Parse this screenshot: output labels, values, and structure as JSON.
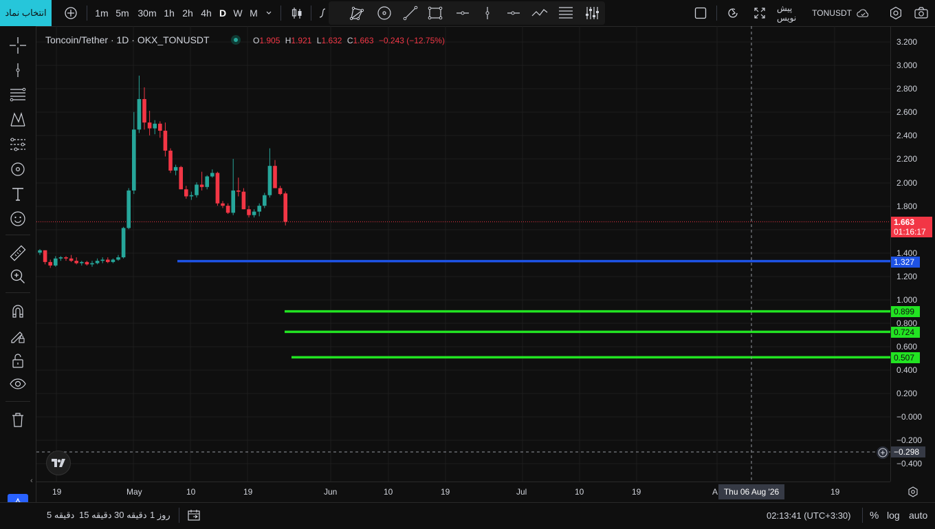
{
  "toolbar": {
    "symbol_search": "انتخاب نماد",
    "intervals": [
      "1m",
      "5m",
      "30m",
      "1h",
      "2h",
      "4h",
      "D",
      "W",
      "M"
    ],
    "active_interval": "D",
    "symbol": "TONUSDT",
    "preview_label": "پیش نویس"
  },
  "legend": {
    "title": "Toncoin/Tether · 1D · OKX_TONUSDT",
    "open_label": "O",
    "open": "1.905",
    "high_label": "H",
    "high": "1.921",
    "low_label": "L",
    "low": "1.632",
    "close_label": "C",
    "close": "1.663",
    "change": "−0.243 (−12.75%)"
  },
  "price_axis": {
    "ticks": [
      "3.200",
      "3.000",
      "2.800",
      "2.600",
      "2.400",
      "2.200",
      "2.000",
      "1.800",
      "1.400",
      "1.200",
      "1.000",
      "0.800",
      "0.600",
      "0.400",
      "0.200",
      "−0.000",
      "−0.200",
      "−0.400"
    ],
    "last_price": "1.663",
    "countdown": "01:16:17",
    "crosshair_price": "−0.298",
    "line_labels": [
      "1.327",
      "0.899",
      "0.724",
      "0.507"
    ]
  },
  "time_axis": {
    "ticks": [
      "19",
      "May",
      "10",
      "19",
      "Jun",
      "10",
      "19",
      "Jul",
      "10",
      "19",
      "A",
      "19"
    ],
    "crosshair_date": "Thu 06 Aug '26"
  },
  "bottom": {
    "ranges": [
      "5 دقیقه",
      "15 دقیقه",
      "30 دقیقه",
      "1 روز"
    ],
    "clock": "02:13:41 (UTC+3:30)",
    "percent": "%",
    "log": "log",
    "auto": "auto"
  },
  "colors": {
    "up": "#26a69a",
    "down": "#f23645",
    "blue_line": "#1e53e5",
    "green_line": "#22e322",
    "accent": "#26c6da"
  },
  "chart_data": {
    "type": "candlestick",
    "ylim": [
      -0.5,
      3.3
    ],
    "levels": [
      1.327,
      0.899,
      0.724,
      0.507
    ],
    "candles": [
      [
        1.4,
        1.43,
        1.38,
        1.42
      ],
      [
        1.42,
        1.42,
        1.3,
        1.32
      ],
      [
        1.32,
        1.34,
        1.27,
        1.29
      ],
      [
        1.29,
        1.37,
        1.28,
        1.35
      ],
      [
        1.35,
        1.37,
        1.33,
        1.36
      ],
      [
        1.36,
        1.37,
        1.33,
        1.35
      ],
      [
        1.35,
        1.38,
        1.32,
        1.33
      ],
      [
        1.33,
        1.36,
        1.3,
        1.31
      ],
      [
        1.31,
        1.33,
        1.29,
        1.32
      ],
      [
        1.32,
        1.33,
        1.29,
        1.3
      ],
      [
        1.3,
        1.33,
        1.28,
        1.31
      ],
      [
        1.31,
        1.35,
        1.3,
        1.33
      ],
      [
        1.33,
        1.36,
        1.31,
        1.34
      ],
      [
        1.34,
        1.36,
        1.31,
        1.32
      ],
      [
        1.32,
        1.35,
        1.31,
        1.34
      ],
      [
        1.34,
        1.38,
        1.33,
        1.36
      ],
      [
        1.36,
        1.62,
        1.35,
        1.61
      ],
      [
        1.61,
        1.95,
        1.6,
        1.93
      ],
      [
        1.93,
        2.6,
        1.9,
        2.45
      ],
      [
        2.45,
        2.91,
        2.42,
        2.71
      ],
      [
        2.71,
        2.81,
        2.45,
        2.51
      ],
      [
        2.51,
        2.61,
        2.4,
        2.46
      ],
      [
        2.46,
        2.53,
        2.41,
        2.5
      ],
      [
        2.5,
        2.52,
        2.38,
        2.44
      ],
      [
        2.44,
        2.51,
        2.22,
        2.27
      ],
      [
        2.27,
        2.29,
        2.08,
        2.1
      ],
      [
        2.1,
        2.15,
        2.06,
        2.13
      ],
      [
        2.13,
        2.14,
        1.94,
        1.94
      ],
      [
        1.94,
        1.97,
        1.86,
        1.88
      ],
      [
        1.88,
        1.92,
        1.85,
        1.89
      ],
      [
        1.89,
        2.0,
        1.87,
        1.98
      ],
      [
        1.98,
        2.09,
        1.93,
        1.96
      ],
      [
        1.96,
        2.06,
        1.94,
        2.05
      ],
      [
        2.05,
        2.11,
        2.04,
        2.08
      ],
      [
        2.08,
        2.09,
        1.8,
        1.82
      ],
      [
        1.82,
        1.84,
        1.78,
        1.8
      ],
      [
        1.8,
        1.82,
        1.73,
        1.74
      ],
      [
        1.74,
        2.2,
        1.72,
        1.93
      ],
      [
        1.93,
        2.04,
        1.88,
        1.92
      ],
      [
        1.92,
        1.95,
        1.77,
        1.77
      ],
      [
        1.77,
        1.8,
        1.7,
        1.72
      ],
      [
        1.72,
        1.77,
        1.7,
        1.75
      ],
      [
        1.75,
        1.82,
        1.71,
        1.8
      ],
      [
        1.8,
        1.91,
        1.78,
        1.89
      ],
      [
        1.89,
        2.29,
        1.87,
        2.14
      ],
      [
        2.14,
        2.19,
        1.95,
        1.95
      ],
      [
        1.95,
        1.97,
        1.89,
        1.9
      ],
      [
        1.905,
        1.921,
        1.632,
        1.663
      ]
    ]
  }
}
